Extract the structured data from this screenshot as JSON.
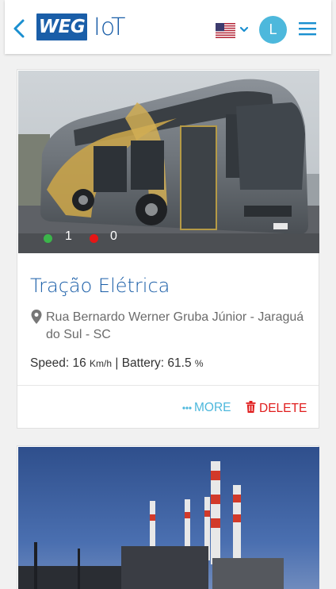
{
  "header": {
    "logo_text": "WEG",
    "app_name": "IoT",
    "language_icon": "us-flag-icon",
    "avatar_initial": "L",
    "brand_color": "#1a5ea8",
    "accent_color": "#4db8dc"
  },
  "cards": [
    {
      "title": "Tração Elétrica",
      "image": "electric-bus-photo",
      "online_count": "1",
      "offline_count": "0",
      "address": "Rua Bernardo Werner Gruba Júnior - Jaraguá do Sul - SC",
      "speed_label": "Speed:",
      "speed_value": "16",
      "speed_unit": "Km/h",
      "separator": "|",
      "battery_label": "Battery:",
      "battery_value": "61.5",
      "battery_unit": "%",
      "more_label": "MORE",
      "delete_label": "DELETE"
    },
    {
      "image": "industrial-chimneys-photo"
    }
  ],
  "status_colors": {
    "online": "#3bb54a",
    "offline": "#e51616",
    "delete": "#e01e1e"
  }
}
